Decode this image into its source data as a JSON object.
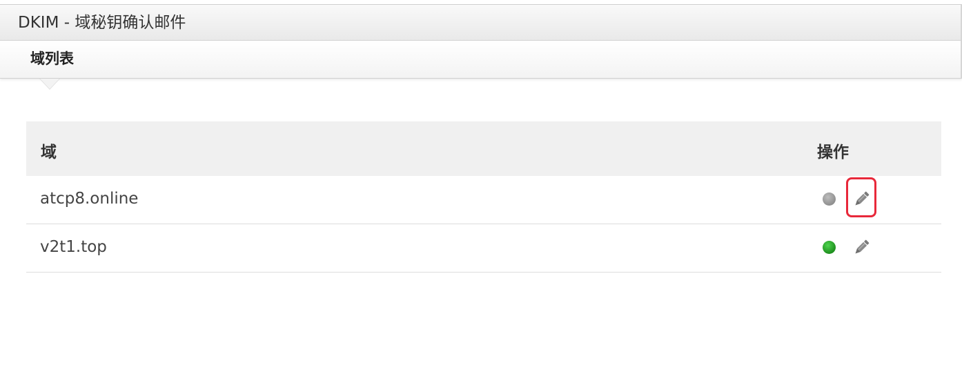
{
  "window": {
    "title": "DKIM - 域秘钥确认邮件"
  },
  "section": {
    "title": "域列表"
  },
  "table": {
    "headers": {
      "domain": "域",
      "actions": "操作"
    },
    "rows": [
      {
        "domain": "atcp8.online",
        "status_color": "#9a9a9a",
        "edit_icon": "pencil-icon",
        "highlighted": true
      },
      {
        "domain": "v2t1.top",
        "status_color": "#22a022",
        "edit_icon": "pencil-icon",
        "highlighted": false
      }
    ]
  },
  "colors": {
    "highlight": "#e8283a",
    "status_active": "#22a022",
    "status_inactive": "#9a9a9a"
  }
}
